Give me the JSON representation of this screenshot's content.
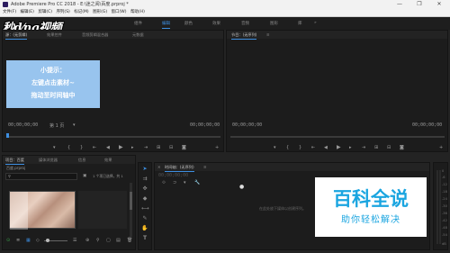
{
  "window": {
    "title": "Adobe Premiere Pro CC 2018 - E:\\迷之阅\\百度.prproj *",
    "minimize": "—",
    "maximize": "❐",
    "close": "✕"
  },
  "menu": [
    "文件(F)",
    "编辑(E)",
    "剪辑(C)",
    "序列(S)",
    "标记(M)",
    "图形(G)",
    "窗口(W)",
    "帮助(H)"
  ],
  "workspaces": [
    {
      "label": "组件",
      "active": false
    },
    {
      "label": "编辑",
      "active": true
    },
    {
      "label": "颜色",
      "active": false
    },
    {
      "label": "效果",
      "active": false
    },
    {
      "label": "音频",
      "active": false
    },
    {
      "label": "图形",
      "active": false
    },
    {
      "label": "库",
      "active": false
    }
  ],
  "workspace_menu_icon": "≡",
  "workspace_more": "»",
  "logo_text": "秒d⁄ng视频",
  "source_panel": {
    "tabs": [
      "源：(无剪辑)",
      "效果控件",
      "音频剪辑混合器",
      "元数据"
    ],
    "timecode_left": "00;00;00;00",
    "page_select": "第 1 页",
    "timecode_right": "00;00;00;00"
  },
  "hint": {
    "line1": "小提示：",
    "line2": "左键点击素材~",
    "line3": "拖动至时间轴中"
  },
  "program_panel": {
    "tab": "节目：(无序列)",
    "timecode_left": "00;00;00;00",
    "timecode_right": "00;00;00;00"
  },
  "project_panel": {
    "tabs": [
      "项目：百度",
      "媒体浏览器",
      "信息",
      "效果"
    ],
    "project_file": "百度.prproj",
    "selection_text": "1 个项已选择，共 1",
    "search_placeholder": "🔍"
  },
  "timeline": {
    "tab": "时间轴：(无序列)",
    "timecode": "00;00;00;00",
    "drop_text": "在此处放下媒体以创建序列。"
  },
  "meter": [
    "0",
    "-6",
    "-12",
    "-18",
    "-24",
    "-30",
    "-36",
    "-42",
    "-48",
    "-54",
    "dB"
  ],
  "watermark": {
    "title": "百科全说",
    "subtitle": "助你轻松解决"
  },
  "colors": {
    "accent": "#3d8ee0",
    "hint_bg": "#98c4ee",
    "panel_bg": "#1c1c1c",
    "watermark_text": "#1aa5e0"
  }
}
